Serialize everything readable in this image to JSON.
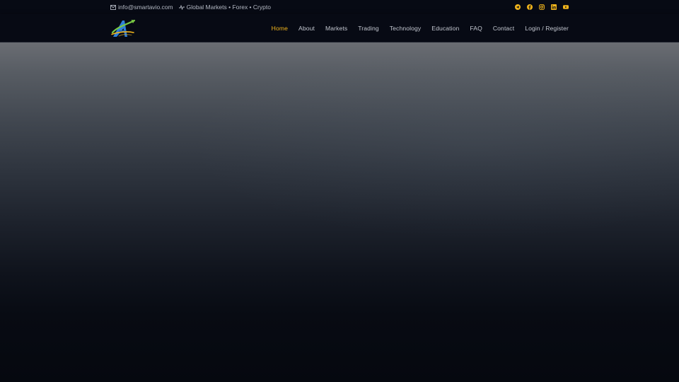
{
  "topbar": {
    "email": "info@smartavio.com",
    "tagline": "Global Markets • Forex • Crypto",
    "socials": [
      {
        "icon": "telegram-icon"
      },
      {
        "icon": "facebook-icon"
      },
      {
        "icon": "instagram-icon"
      },
      {
        "icon": "linkedin-icon"
      },
      {
        "icon": "youtube-icon"
      }
    ]
  },
  "nav": {
    "items": [
      {
        "label": "Home"
      },
      {
        "label": "About"
      },
      {
        "label": "Markets"
      },
      {
        "label": "Trading"
      },
      {
        "label": "Technology"
      },
      {
        "label": "Education"
      },
      {
        "label": "FAQ"
      },
      {
        "label": "Contact"
      },
      {
        "label": "Login / Register"
      }
    ],
    "active": "Home"
  },
  "colors": {
    "accent": "#f2b51c",
    "background": "#050812",
    "nav_text": "#c4c8d1"
  }
}
